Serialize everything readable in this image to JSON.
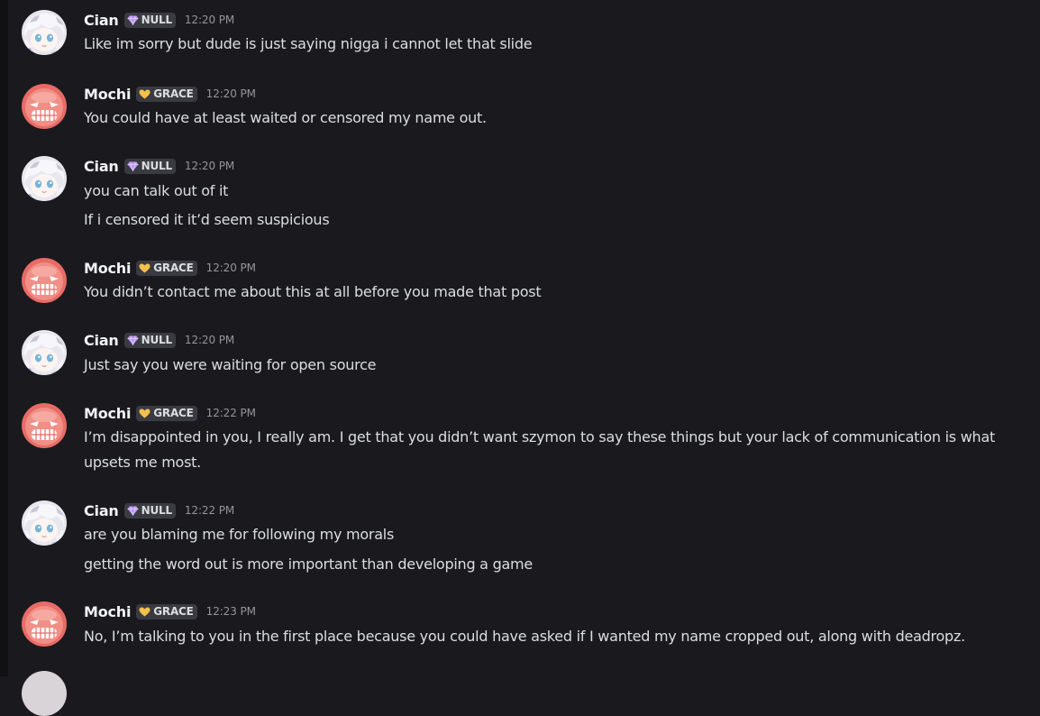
{
  "colors": {
    "background": "#1a1a1e",
    "username": "#f2f3f5",
    "message_text": "#dbdee1",
    "timestamp": "#94959c",
    "tag_background": "#3a3a42",
    "null_tag_icon": "#b892f0",
    "grace_tag_icon": "#f3c04b"
  },
  "tags": {
    "null": {
      "label": "NULL",
      "icon": "gem-icon"
    },
    "grace": {
      "label": "GRACE",
      "icon": "heart-icon"
    }
  },
  "users": {
    "cian": {
      "name": "Cian",
      "avatar": "white-hair-anime-avatar"
    },
    "mochi": {
      "name": "Mochi",
      "avatar": "red-round-creature-avatar"
    }
  },
  "messages": [
    {
      "author": "Cian",
      "tag": "NULL",
      "time": "12:20 PM",
      "lines": [
        "Like im sorry but dude is just saying nigga i cannot let that slide"
      ]
    },
    {
      "author": "Mochi",
      "tag": "GRACE",
      "time": "12:20 PM",
      "lines": [
        "You could have at least waited or censored my name out."
      ]
    },
    {
      "author": "Cian",
      "tag": "NULL",
      "time": "12:20 PM",
      "lines": [
        "you can talk out of it",
        "If i censored it it’d seem suspicious"
      ]
    },
    {
      "author": "Mochi",
      "tag": "GRACE",
      "time": "12:20 PM",
      "lines": [
        "You didn’t contact me about this at all before you made that post"
      ]
    },
    {
      "author": "Cian",
      "tag": "NULL",
      "time": "12:20 PM",
      "lines": [
        "Just say you were waiting for open source"
      ]
    },
    {
      "author": "Mochi",
      "tag": "GRACE",
      "time": "12:22 PM",
      "lines": [
        "I’m disappointed in you, I really am. I get that you didn’t want szymon to say these things but your lack of communication is what upsets me most."
      ]
    },
    {
      "author": "Cian",
      "tag": "NULL",
      "time": "12:22 PM",
      "lines": [
        "are you blaming me for following my morals",
        "getting the word out is more important than developing a game"
      ]
    },
    {
      "author": "Mochi",
      "tag": "GRACE",
      "time": "12:23 PM",
      "lines": [
        "No, I’m talking to you in the first place because you could have asked if I wanted my name cropped out, along with deadropz."
      ]
    }
  ]
}
